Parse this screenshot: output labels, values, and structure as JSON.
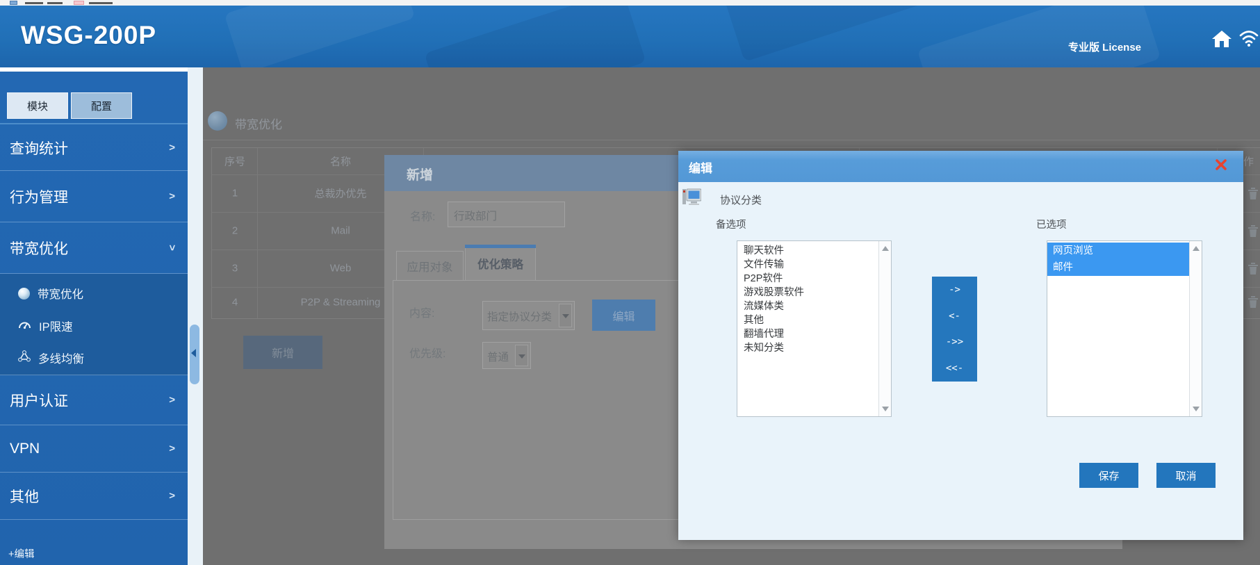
{
  "header": {
    "title": "WSG-200P",
    "license": "专业版 License"
  },
  "sidebar": {
    "tabs": [
      "模块",
      "配置"
    ],
    "menu_top": [
      {
        "label": "查询统计",
        "arrow": ">"
      },
      {
        "label": "行为管理",
        "arrow": ">"
      },
      {
        "label": "带宽优化",
        "arrow": ">"
      }
    ],
    "submenu": [
      "带宽优化",
      "IP限速",
      "多线均衡"
    ],
    "menu_bottom": [
      {
        "label": "用户认证",
        "arrow": ">"
      },
      {
        "label": "VPN",
        "arrow": ">"
      },
      {
        "label": "其他",
        "arrow": ">"
      }
    ],
    "edit_link": "+编辑"
  },
  "page": {
    "title": "带宽优化",
    "add_button": "新增",
    "table": {
      "headers": [
        "序号",
        "名称",
        "应用对象",
        "操作"
      ],
      "rows": [
        {
          "no": "1",
          "name": "总裁办优先"
        },
        {
          "no": "2",
          "name": "Mail"
        },
        {
          "no": "3",
          "name": "Web"
        },
        {
          "no": "4",
          "name": "P2P & Streaming"
        }
      ]
    }
  },
  "add_modal": {
    "title": "新增",
    "name_label": "名称:",
    "name_value": "行政部门",
    "tabs": [
      "应用对象",
      "优化策略"
    ],
    "active_tab": "优化策略",
    "content_label": "内容:",
    "content_value": "指定协议分类",
    "edit_button": "编辑",
    "priority_label": "优先级:",
    "priority_value": "普通"
  },
  "edit_modal": {
    "title": "编辑",
    "section_label": "协议分类",
    "available_label": "备选项",
    "selected_label": "已选项",
    "available_items": [
      "聊天软件",
      "文件传输",
      "P2P软件",
      "游戏股票软件",
      "流媒体类",
      "其他",
      "翻墙代理",
      "未知分类"
    ],
    "selected_items": [
      "网页浏览",
      "邮件"
    ],
    "transfer_buttons": [
      "->",
      "<-",
      "->>",
      "<<-"
    ],
    "save_button": "保存",
    "cancel_button": "取消"
  },
  "colors": {
    "header_blue": "#2170b7",
    "sidebar_blue": "#2268b2",
    "submenu_blue": "#1e5c9d",
    "modal_header_blue": "#579cd9",
    "accent_button_blue": "#2376bd",
    "selected_item_blue": "#3b98f1",
    "close_red": "#e8432f",
    "dim_overlay_gray": "#6f6f6f"
  }
}
